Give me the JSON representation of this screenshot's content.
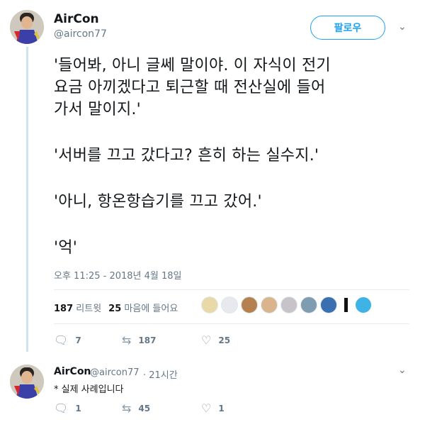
{
  "tweet": {
    "author_name": "AirCon",
    "author_handle": "@aircon77",
    "follow_label": "팔로우",
    "lines": [
      "'들어봐, 아니 글쎄 말이야. 이 자식이 전기",
      "요금 아끼겠다고 퇴근할 때 전산실에 들어",
      "가서 말이지.'",
      "'서버를 끄고 갔다고? 흔히 하는 실수지.'",
      "'아니, 항온항습기를 끄고 갔어.'",
      "'억'"
    ],
    "timestamp": "오후 11:25 - 2018년 4월 18일",
    "retweet_count": "187",
    "retweet_label": "리트윗",
    "like_count": "25",
    "like_label": "마음에 들어요",
    "actions": {
      "reply": "7",
      "retweet": "187",
      "like": "25"
    }
  },
  "reply": {
    "author_name": "AirCon",
    "author_handle": "@aircon77",
    "time": "· 21시간",
    "text": "* 실제 사례입니다",
    "actions": {
      "reply": "1",
      "retweet": "45",
      "like": "1"
    }
  },
  "colors": {
    "accent": "#1da1f2",
    "muted": "#657786",
    "thread_line": "#cfe3f2"
  },
  "icons": {
    "reply": "reply-icon",
    "retweet": "retweet-icon",
    "like": "heart-icon",
    "caret": "chevron-down-icon"
  }
}
